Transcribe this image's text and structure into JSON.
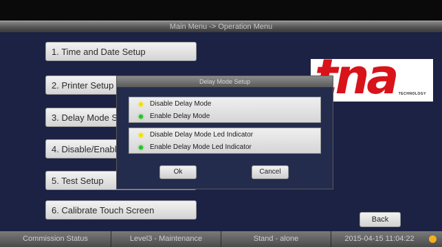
{
  "title": "Main Menu -> Operation Menu",
  "menu": [
    {
      "label": "1. Time and Date Setup"
    },
    {
      "label": "2. Printer Setup"
    },
    {
      "label": "3. Delay Mode Setup"
    },
    {
      "label": "4. Disable/Enable"
    },
    {
      "label": "5. Test Setup"
    },
    {
      "label": "6. Calibrate Touch Screen"
    }
  ],
  "logo": {
    "brand": "tna",
    "tagline": "TECHNOLOGY",
    "color": "#d8131a"
  },
  "back_label": "Back",
  "dialog": {
    "title": "Delay Mode Setup",
    "group1": [
      {
        "label": "Disable Delay Mode",
        "led": "#f2e200"
      },
      {
        "label": "Enable Delay Mode",
        "led": "#22c422"
      }
    ],
    "group2": [
      {
        "label": "Disable Delay Mode Led Indicator",
        "led": "#f2e200"
      },
      {
        "label": "Enable Delay Mode Led Indicator",
        "led": "#22c422"
      }
    ],
    "ok_label": "Ok",
    "cancel_label": "Cancel"
  },
  "status": {
    "commission": "Commission Status",
    "level": "Level3 - Maintenance",
    "mode": "Stand - alone",
    "datetime": "2015-04-15 11:04:22",
    "indicator_color": "#f0b020"
  }
}
